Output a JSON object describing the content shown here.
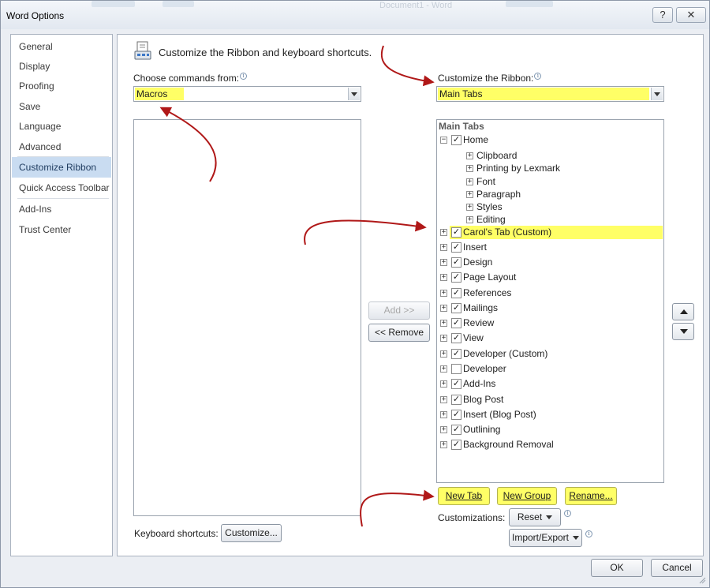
{
  "window": {
    "title": "Word Options",
    "background_title": "Document1 - Word",
    "help_label": "?",
    "close_label": "✕"
  },
  "nav": {
    "items": [
      {
        "label": "General"
      },
      {
        "label": "Display"
      },
      {
        "label": "Proofing"
      },
      {
        "label": "Save"
      },
      {
        "label": "Language"
      },
      {
        "label": "Advanced"
      },
      {
        "label": "Customize Ribbon"
      },
      {
        "label": "Quick Access Toolbar"
      },
      {
        "label": "Add-Ins"
      },
      {
        "label": "Trust Center"
      }
    ],
    "selected": "Customize Ribbon"
  },
  "main": {
    "heading": "Customize the Ribbon and keyboard shortcuts.",
    "choose_label": "Choose commands from:",
    "choose_value": "Macros",
    "ribbon_label": "Customize the Ribbon:",
    "ribbon_value": "Main Tabs",
    "info_glyph": "i",
    "add_button": "Add >>",
    "remove_button": "<< Remove",
    "tree_header": "Main Tabs",
    "tree": [
      {
        "label": "Home",
        "level": 0,
        "expander": "⊟",
        "checked": true
      },
      {
        "label": "Clipboard",
        "level": 1,
        "expander": "⊞"
      },
      {
        "label": "Printing by Lexmark",
        "level": 1,
        "expander": "⊞"
      },
      {
        "label": "Font",
        "level": 1,
        "expander": "⊞"
      },
      {
        "label": "Paragraph",
        "level": 1,
        "expander": "⊞"
      },
      {
        "label": "Styles",
        "level": 1,
        "expander": "⊞"
      },
      {
        "label": "Editing",
        "level": 1,
        "expander": "⊞"
      },
      {
        "label": "Carol's Tab (Custom)",
        "level": 0,
        "expander": "⊞",
        "checked": true,
        "highlight": true
      },
      {
        "label": "Insert",
        "level": 0,
        "expander": "⊞",
        "checked": true
      },
      {
        "label": "Design",
        "level": 0,
        "expander": "⊞",
        "checked": true
      },
      {
        "label": "Page Layout",
        "level": 0,
        "expander": "⊞",
        "checked": true
      },
      {
        "label": "References",
        "level": 0,
        "expander": "⊞",
        "checked": true
      },
      {
        "label": "Mailings",
        "level": 0,
        "expander": "⊞",
        "checked": true
      },
      {
        "label": "Review",
        "level": 0,
        "expander": "⊞",
        "checked": true
      },
      {
        "label": "View",
        "level": 0,
        "expander": "⊞",
        "checked": true
      },
      {
        "label": "Developer (Custom)",
        "level": 0,
        "expander": "⊞",
        "checked": true
      },
      {
        "label": "Developer",
        "level": 0,
        "expander": "⊞",
        "checked": false
      },
      {
        "label": "Add-Ins",
        "level": 0,
        "expander": "⊞",
        "checked": true
      },
      {
        "label": "Blog Post",
        "level": 0,
        "expander": "⊞",
        "checked": true
      },
      {
        "label": "Insert (Blog Post)",
        "level": 0,
        "expander": "⊞",
        "checked": true
      },
      {
        "label": "Outlining",
        "level": 0,
        "expander": "⊞",
        "checked": true
      },
      {
        "label": "Background Removal",
        "level": 0,
        "expander": "⊞",
        "checked": true
      }
    ],
    "check_glyph": "✓",
    "new_tab_button": "New Tab",
    "new_group_button": "New Group",
    "rename_button": "Rename...",
    "customizations_label": "Customizations:",
    "reset_button": "Reset",
    "import_export_button": "Import/Export",
    "keyboard_label": "Keyboard shortcuts:",
    "customize_button": "Customize..."
  },
  "footer": {
    "ok_button": "OK",
    "cancel_button": "Cancel"
  },
  "colors": {
    "highlight": "#ffff66",
    "annotation_arrow": "#b01818",
    "nav_selected": "#c9dcf1"
  }
}
